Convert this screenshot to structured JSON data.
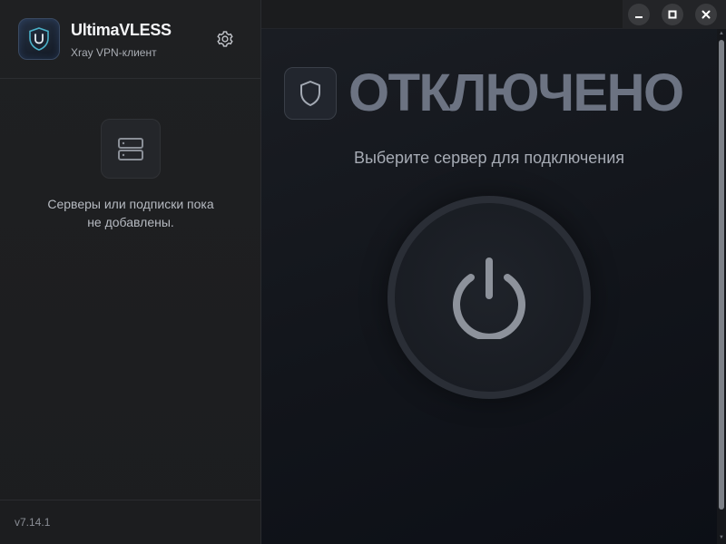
{
  "app": {
    "name": "UltimaVLESS",
    "subtitle": "Xray VPN-клиент",
    "version": "v7.14.1"
  },
  "sidebar": {
    "empty_message": "Серверы или подписки пока не добавлены.",
    "empty_icon": "server-icon",
    "settings_icon": "gear-icon"
  },
  "status": {
    "label": "ОТКЛЮЧЕНО",
    "hint": "Выберите сервер для подключения",
    "icon": "shield-icon",
    "power_icon": "power-icon"
  },
  "window_controls": [
    "minimize-icon",
    "maximize-icon",
    "close-icon"
  ],
  "colors": {
    "accent": "#3f8fd8",
    "status_text": "#6c7382",
    "background": "#14171c"
  }
}
